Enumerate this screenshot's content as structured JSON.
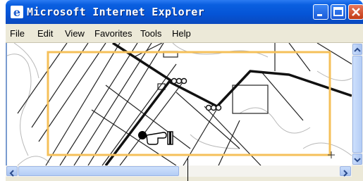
{
  "window": {
    "title": "Microsoft Internet Explorer"
  },
  "menu": [
    "File",
    "Edit",
    "View",
    "Favorites",
    "Tools",
    "Help"
  ],
  "colors": {
    "accent": "#f5c05a",
    "titlebar": "#0554d6"
  },
  "icons": {
    "app": "ie-icon",
    "brand": "windows-xp-logo",
    "cursor": "pointing-hand-cursor"
  }
}
